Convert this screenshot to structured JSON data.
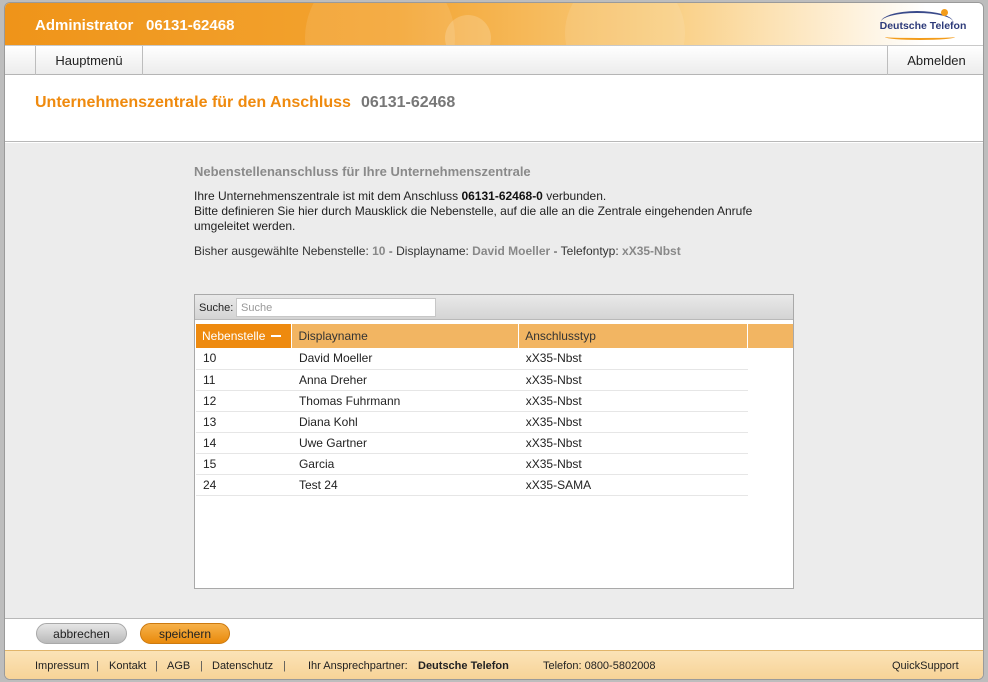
{
  "header": {
    "role": "Administrator",
    "phone": "06131-62468",
    "logo_text": "Deutsche Telefon"
  },
  "nav": {
    "main_menu": "Hauptmenü",
    "logout": "Abmelden"
  },
  "page": {
    "title": "Unternehmenszentrale für den Anschluss",
    "title_number": "06131-62468"
  },
  "section": {
    "title": "Nebenstellenanschluss für Ihre Unternehmenszentrale",
    "desc_pre": "Ihre Unternehmenszentrale ist mit dem Anschluss ",
    "desc_number": "06131-62468-0",
    "desc_post": " verbunden.",
    "desc_line2": "Bitte definieren Sie hier durch Mausklick die Nebenstelle, auf die alle an die Zentrale eingehenden Anrufe umgeleitet werden.",
    "current_label": "Bisher ausgewählte Nebenstelle: ",
    "current_ext": "10",
    "displayname_label": " - Displayname: ",
    "current_name": "David Moeller",
    "phonetype_label": " - Telefontyp: ",
    "current_type": "xX35-Nbst"
  },
  "search": {
    "label": "Suche:",
    "placeholder": "Suche"
  },
  "table": {
    "columns": [
      "Nebenstelle",
      "Displayname",
      "Anschlusstyp"
    ],
    "rows": [
      [
        "10",
        "David Moeller",
        "xX35-Nbst"
      ],
      [
        "11",
        "Anna Dreher",
        "xX35-Nbst"
      ],
      [
        "12",
        "Thomas Fuhrmann",
        "xX35-Nbst"
      ],
      [
        "13",
        "Diana Kohl",
        "xX35-Nbst"
      ],
      [
        "14",
        "Uwe Gartner",
        "xX35-Nbst"
      ],
      [
        "15",
        "Garcia",
        "xX35-Nbst"
      ],
      [
        "24",
        "Test 24",
        "xX35-SAMA"
      ]
    ]
  },
  "buttons": {
    "cancel": "abbrechen",
    "save": "speichern"
  },
  "footer": {
    "impressum": "Impressum",
    "kontakt": "Kontakt",
    "agb": "AGB",
    "datenschutz": "Datenschutz",
    "separator": "|",
    "partner_label": "Ihr Ansprechpartner:",
    "partner_name": "Deutsche Telefon",
    "phone": "Telefon: 0800-5802008",
    "quicksupport": "QuickSupport"
  },
  "colors": {
    "accent": "#ef8a0e",
    "header_orange": "#f3a431",
    "table_header": "#f2b562"
  }
}
